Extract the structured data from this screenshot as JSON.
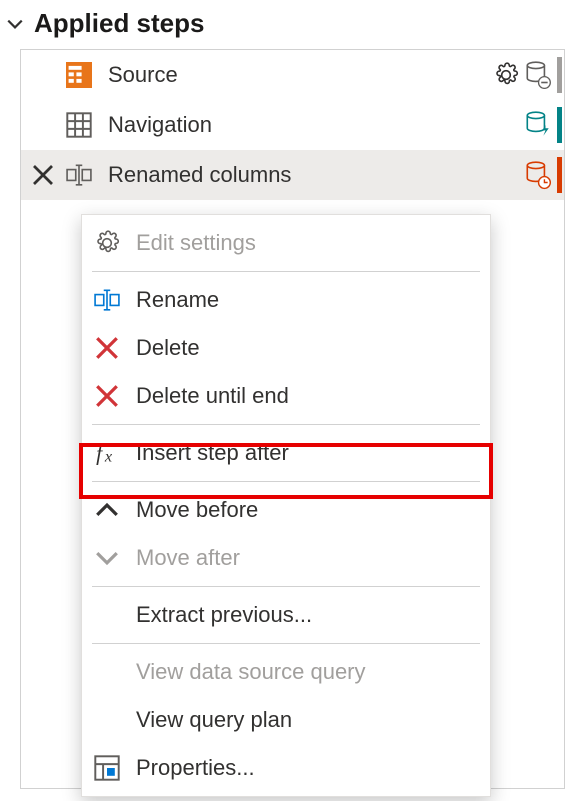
{
  "header": {
    "title": "Applied steps"
  },
  "steps": [
    {
      "label": "Source",
      "icon": "table-icon-orange",
      "gear": true,
      "db": "db-minus",
      "accent": "#a19f9d"
    },
    {
      "label": "Navigation",
      "icon": "table-icon-grey",
      "gear": false,
      "db": "db-lightning",
      "accent": "#038387"
    },
    {
      "label": "Renamed columns",
      "icon": "rename-column-icon",
      "gear": false,
      "db": "db-clock",
      "accent": "#d83b01"
    }
  ],
  "menu": {
    "editSettings": "Edit settings",
    "rename": "Rename",
    "delete": "Delete",
    "deleteUntilEnd": "Delete until end",
    "insertStepAfter": "Insert step after",
    "moveBefore": "Move before",
    "moveAfter": "Move after",
    "extractPrevious": "Extract previous...",
    "viewDataSourceQuery": "View data source query",
    "viewQueryPlan": "View query plan",
    "properties": "Properties..."
  }
}
